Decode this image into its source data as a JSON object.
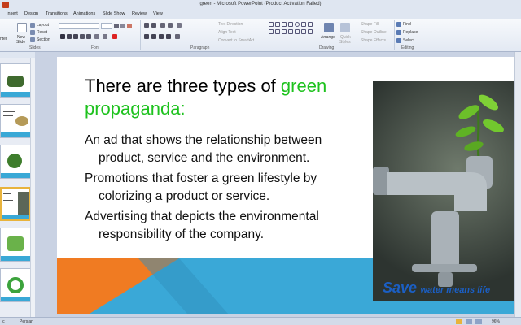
{
  "window": {
    "title": "green - Microsoft PowerPoint (Product Activation Failed)"
  },
  "tabs": [
    "Insert",
    "Design",
    "Transitions",
    "Animations",
    "Slide Show",
    "Review",
    "View"
  ],
  "ribbon": {
    "slides_group": {
      "label": "Slides",
      "new_slide": "New",
      "new_slide_2": "Slide",
      "layout": "Layout",
      "reset": "Reset",
      "section": "Section",
      "clipboard_partial": "nter"
    },
    "font_group": {
      "label": "Font"
    },
    "paragraph_group": {
      "label": "Paragraph",
      "text_direction": "Text Direction",
      "align_text": "Align Text",
      "convert_smartart": "Convert to SmartArt"
    },
    "drawing_group": {
      "label": "Drawing",
      "arrange": "Arrange",
      "quick_styles": "Quick",
      "quick_styles_2": "Styles",
      "shape_fill": "Shape Fill",
      "shape_outline": "Shape Outline",
      "shape_effects": "Shape Effects"
    },
    "editing_group": {
      "label": "Editing",
      "find": "Find",
      "replace": "Replace",
      "select": "Select"
    }
  },
  "slide": {
    "title_part1": "There are three types of ",
    "title_green1": "green",
    "title_green2": "propaganda:",
    "bullets": [
      "An ad that shows the relationship between product, service and the environment.",
      "Promotions that foster a green lifestyle by colorizing a product or service.",
      "Advertising that depicts the environmental responsibility of the company."
    ],
    "image_caption_big": "Save",
    "image_caption_small": "water means life",
    "colors": {
      "green": "#1ec21e",
      "band_blue": "#3aa8d7",
      "band_orange": "#f07b22"
    }
  },
  "statusbar": {
    "left": "ic",
    "language": "Persian",
    "zoom": "96%"
  }
}
